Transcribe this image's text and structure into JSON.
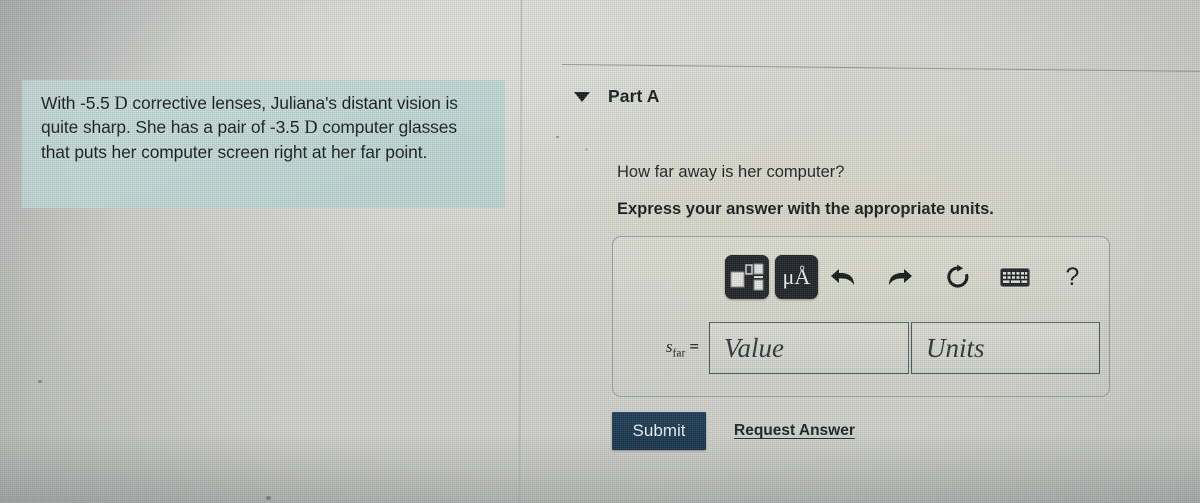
{
  "problem": {
    "text_part1": "With -5.5 ",
    "unit1": "D",
    "text_part2": " corrective lenses, Juliana's distant vision is quite sharp. She has a pair of -3.5 ",
    "unit2": "D",
    "text_part3": " computer glasses that puts her computer screen right at her far point.",
    "highlight_color": "#c9e0de"
  },
  "part": {
    "caret_icon": "triangle-down-icon",
    "title": "Part A",
    "question": "How far away is her computer?",
    "instruction": "Express your answer with the appropriate units."
  },
  "toolbar": {
    "template_button": {
      "icon": "math-template-icon",
      "label": ""
    },
    "units_button": {
      "icon": "greek-units-icon",
      "label": "μÅ"
    },
    "undo": {
      "icon": "undo-arrow-icon",
      "glyph": "⮠"
    },
    "redo": {
      "icon": "redo-arrow-icon",
      "glyph": "⮡"
    },
    "reset": {
      "icon": "reset-circular-arrow-icon",
      "glyph": "↻"
    },
    "keyboard": {
      "icon": "keyboard-icon",
      "glyph": "⌨"
    },
    "help": {
      "icon": "help-question-mark-icon",
      "glyph": "?"
    }
  },
  "answer": {
    "label_symbol": "s",
    "label_subscript": "far",
    "label_equals": "=",
    "value_placeholder": "Value",
    "value": "",
    "units_placeholder": "Units",
    "units": ""
  },
  "actions": {
    "submit_label": "Submit",
    "submit_color": "#163550",
    "request_answer_label": "Request Answer"
  }
}
